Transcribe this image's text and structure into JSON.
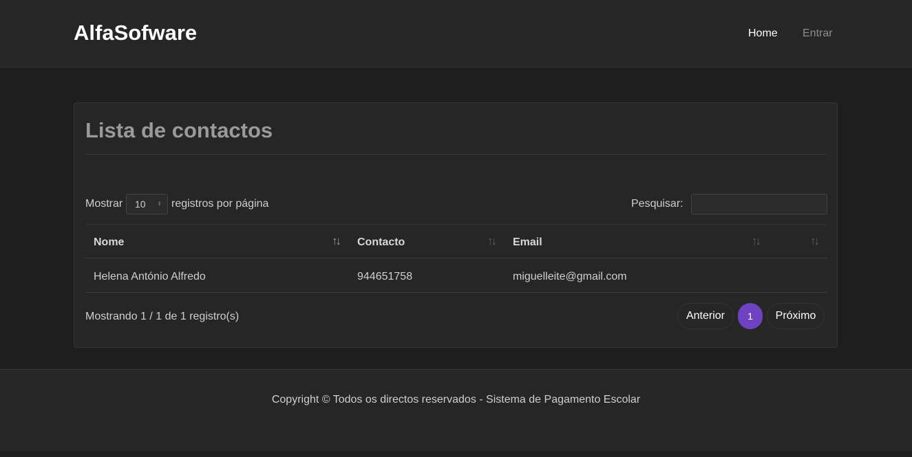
{
  "navbar": {
    "brand": "AlfaSofware",
    "links": [
      {
        "label": "Home"
      },
      {
        "label": "Entrar"
      }
    ]
  },
  "card": {
    "title": "Lista de contactos",
    "length": {
      "prefix": "Mostrar",
      "value": "10",
      "suffix": "registros por página"
    },
    "search": {
      "label": "Pesquisar:",
      "value": ""
    },
    "table": {
      "columns": [
        "Nome",
        "Contacto",
        "Email",
        ""
      ],
      "rows": [
        [
          "Helena António Alfredo",
          "944651758",
          "miguelleite@gmail.com",
          ""
        ]
      ]
    },
    "info": "Mostrando 1 / 1 de 1 registro(s)",
    "pagination": {
      "prev": "Anterior",
      "current": "1",
      "next": "Próximo"
    },
    "colors": {
      "accent": "#6f42c1"
    }
  },
  "footer": {
    "text": "Copyright © Todos os directos reservados - Sistema de Pagamento Escolar"
  },
  "icons": {
    "sort": "sort-icon"
  }
}
